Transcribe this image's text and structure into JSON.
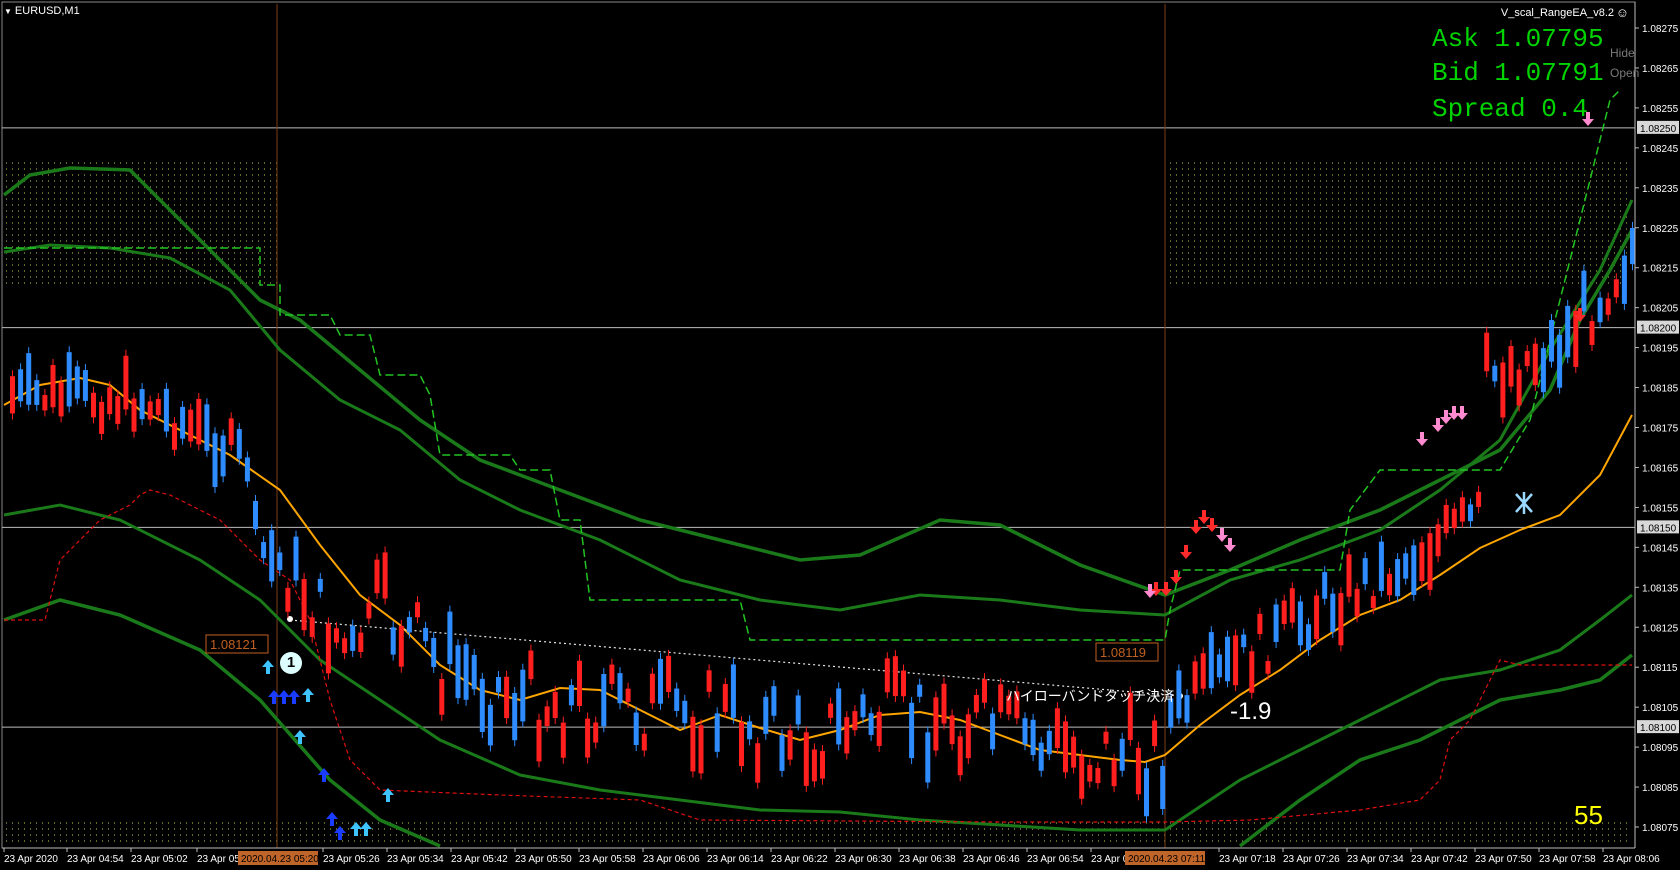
{
  "window": {
    "symbol_title": "EURUSD,M1",
    "ea_name": "V_scal_RangeEA_v8.2",
    "ea_icon": "smiley-icon"
  },
  "quotes": {
    "ask": "Ask 1.07795",
    "bid": "Bid 1.07791",
    "spread": "Spread 0.4"
  },
  "side_buttons": {
    "hide": "Hide",
    "open": "Open"
  },
  "annotations": {
    "counter": "55",
    "profit": "-1.9",
    "close_message": "ハイローバンドタッチ決済",
    "level_left": "1.08121",
    "level_right": "1.08119",
    "signal_marker": "1"
  },
  "price_axis": {
    "ticks": [
      "1.08275",
      "1.08265",
      "1.08255",
      "1.08245",
      "1.08235",
      "1.08225",
      "1.08215",
      "1.08205",
      "1.08195",
      "1.08185",
      "1.08175",
      "1.08165",
      "1.08155",
      "1.08145",
      "1.08135",
      "1.08125",
      "1.08115",
      "1.08105",
      "1.08095",
      "1.08085",
      "1.08075"
    ],
    "highlighted": [
      "1.08250",
      "1.08200",
      "1.08150",
      "1.08100"
    ]
  },
  "time_axis": {
    "labels": [
      "23 Apr 2020",
      "23 Apr 04:54",
      "23 Apr 05:02",
      "23 Apr 05",
      "23 Apr 05:26",
      "23 Apr 05:34",
      "23 Apr 05:42",
      "23 Apr 05:50",
      "23 Apr 05:58",
      "23 Apr 06:06",
      "23 Apr 06:14",
      "23 Apr 06:22",
      "23 Apr 06:30",
      "23 Apr 06:38",
      "23 Apr 06:46",
      "23 Apr 06:54",
      "23 Apr 07:02",
      "23 Apr 07:18",
      "23 Apr 07:26",
      "23 Apr 07:34",
      "23 Apr 07:42",
      "23 Apr 07:50",
      "23 Apr 07:58",
      "23 Apr 08:06"
    ],
    "highlighted": [
      "2020.04.23 05:20",
      "2020.04.23 07:11"
    ]
  },
  "colors": {
    "bull": "#2e8cff",
    "bear": "#ff1f1f",
    "ma": "#ffa500",
    "band": "#1a7a1a",
    "highlight_orange": "#c06020",
    "quote_green": "#00d400"
  },
  "chart_data": {
    "type": "candlestick",
    "symbol": "EURUSD",
    "timeframe": "M1",
    "ylim": [
      1.0807,
      1.0828
    ],
    "current_ask": 1.07795,
    "current_bid": 1.07791,
    "horizontal_levels": [
      1.0825,
      1.082,
      1.0815,
      1.081
    ],
    "marked_levels": [
      1.08121,
      1.08119
    ],
    "profit": -1.9
  }
}
